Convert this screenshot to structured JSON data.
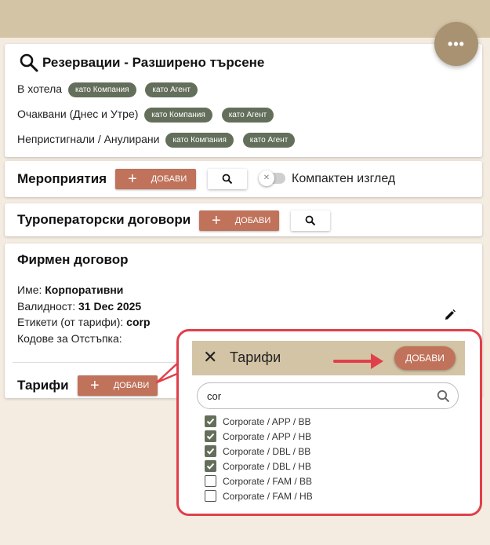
{
  "fab": {
    "label": "•••"
  },
  "reservations": {
    "title": "Резервации - Разширено търсене",
    "rows": [
      {
        "label": "В хотела",
        "chip1": "като Компания",
        "chip2": "като Агент"
      },
      {
        "label": "Очаквани (Днес и Утре)",
        "chip1": "като Компания",
        "chip2": "като Агент"
      },
      {
        "label": "Непристигнали / Анулирани",
        "chip1": "като Компания",
        "chip2": "като Агент"
      }
    ]
  },
  "events": {
    "title": "Мероприятия",
    "add_label": "ДОБАВИ",
    "toggle_label": "Компактен изглед"
  },
  "tour": {
    "title": "Туроператорски договори",
    "add_label": "ДОБАВИ"
  },
  "contract": {
    "title": "Фирмен договор",
    "name_label": "Име:",
    "name_value": "Корпоративни",
    "validity_label": "Валидност:",
    "validity_value": "31 Dec 2025",
    "tags_label": "Етикети (от тарифи):",
    "tags_value": "corp",
    "codes_label": "Кодове за Отстъпка:",
    "rates_title": "Тарифи",
    "rates_add": "ДОБАВИ"
  },
  "dialog": {
    "title": "Тарифи",
    "add_label": "ДОБАВИ",
    "search_value": "cor",
    "items": [
      {
        "label": "Corporate / APP / BB",
        "checked": true
      },
      {
        "label": "Corporate / APP / HB",
        "checked": true
      },
      {
        "label": "Corporate / DBL / BB",
        "checked": true
      },
      {
        "label": "Corporate / DBL / HB",
        "checked": true
      },
      {
        "label": "Corporate / FAM / BB",
        "checked": false
      },
      {
        "label": "Corporate / FAM / HB",
        "checked": false
      }
    ]
  },
  "colors": {
    "header": "#d4c4a6",
    "accent": "#c0725b",
    "chip": "#646f5b",
    "highlight": "#e0404a"
  }
}
